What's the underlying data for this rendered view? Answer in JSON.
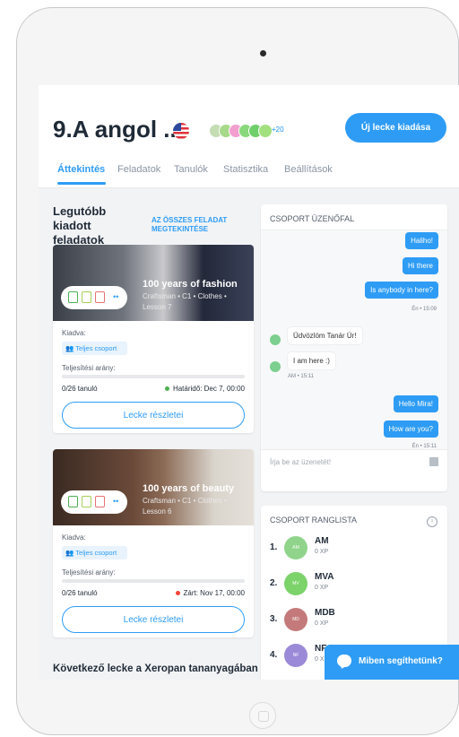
{
  "header": {
    "title": "9.A angol ...",
    "avatar_more": "+20",
    "avatar_colors": [
      "#c5ddb3",
      "#a6d98a",
      "#f29fd0",
      "#8ad87c",
      "#6fcf6a",
      "#a3e07f"
    ],
    "new_lesson_label": "Új lecke kiadása"
  },
  "tabs": [
    {
      "label": "Áttekintés",
      "active": true
    },
    {
      "label": "Feladatok"
    },
    {
      "label": "Tanulók"
    },
    {
      "label": "Statisztika"
    },
    {
      "label": "Beállítások"
    }
  ],
  "recent": {
    "title": "Legutóbb kiadott feladatok",
    "all_link": "AZ ÖSSZES FELADAT MEGTEKINTÉSE"
  },
  "cards": [
    {
      "title": "100 years of fashion",
      "subtitle": "Craftsman • C1 • Clothes • Lesson 7",
      "assigned_label": "Kiadva:",
      "group": "Teljes csoport",
      "rate_label": "Teljesítési arány:",
      "count": "0/26 tanuló",
      "deadline": "Határidő: Dec 7, 00:00",
      "status_color": "#4caf50",
      "button": "Lecke részletei"
    },
    {
      "title": "100 years of beauty",
      "subtitle": "Craftsman • C1 • Clothes • Lesson 6",
      "assigned_label": "Kiadva:",
      "group": "Teljes csoport",
      "rate_label": "Teljesítési arány:",
      "count": "0/26 tanuló",
      "deadline": "Zárt: Nov 17, 00:00",
      "status_color": "#f44336",
      "button": "Lecke részletei"
    }
  ],
  "next_lesson": {
    "title": "Következő lecke a Xeropan tananyagában"
  },
  "chat": {
    "title": "CSOPORT ÜZENŐFAL",
    "outgoing_1": [
      "Haliho!",
      "Hi there",
      "Is anybody in here?"
    ],
    "time_1": "Én • 15:09",
    "incoming": [
      "Üdvözlöm Tanár Úr!",
      "I am here :)"
    ],
    "time_2": "AM • 15:11",
    "outgoing_2": [
      "Hello Mira!",
      "How are you?"
    ],
    "time_3": "Én • 15:11",
    "placeholder": "Írja be az üzenetét!"
  },
  "ranking": {
    "title": "CSOPORT RANGLISTA",
    "rows": [
      {
        "rank": "1.",
        "initials": "AM",
        "name": "AM",
        "xp": "0 XP",
        "color": "#8fd48a"
      },
      {
        "rank": "2.",
        "initials": "MV",
        "name": "MVA",
        "xp": "0 XP",
        "color": "#7bd36a"
      },
      {
        "rank": "3.",
        "initials": "MD",
        "name": "MDB",
        "xp": "0 XP",
        "color": "#c47a7a"
      },
      {
        "rank": "4.",
        "initials": "NF",
        "name": "NF",
        "xp": "0 X",
        "color": "#9a8ad8"
      }
    ]
  },
  "help": {
    "label": "Miben segíthetünk?"
  }
}
